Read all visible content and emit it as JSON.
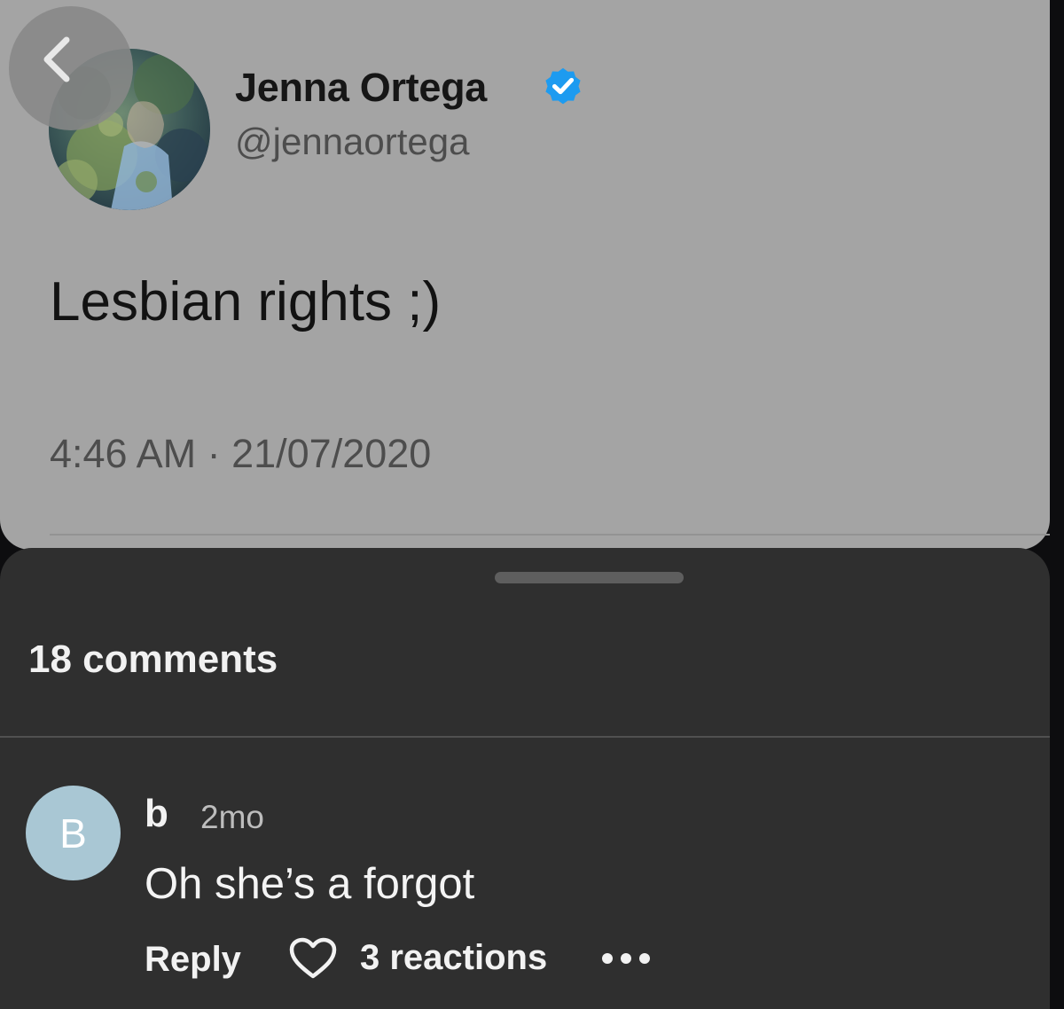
{
  "tweet": {
    "author_name": "Jenna Ortega",
    "author_handle": "@jennaortega",
    "verified": true,
    "text": "Lesbian rights ;)",
    "timestamp": "4:46 AM · 21/07/2020",
    "icons": {
      "back": "chevron-left-icon",
      "verified": "verified-badge-icon"
    }
  },
  "comments_sheet": {
    "count_label": "18 comments",
    "comments": [
      {
        "avatar_letter": "B",
        "author": "b",
        "age": "2mo",
        "text": "Oh she’s a forgot",
        "reply_label": "Reply",
        "reactions_label": "3 reactions",
        "icons": [
          "heart-icon",
          "more-options-icon"
        ]
      }
    ]
  },
  "colors": {
    "card_background": "#a4a4a4",
    "sheet_background": "#2f2f2f",
    "verified_blue": "#1d9bf0",
    "comment_avatar": "#a9c7d4"
  }
}
